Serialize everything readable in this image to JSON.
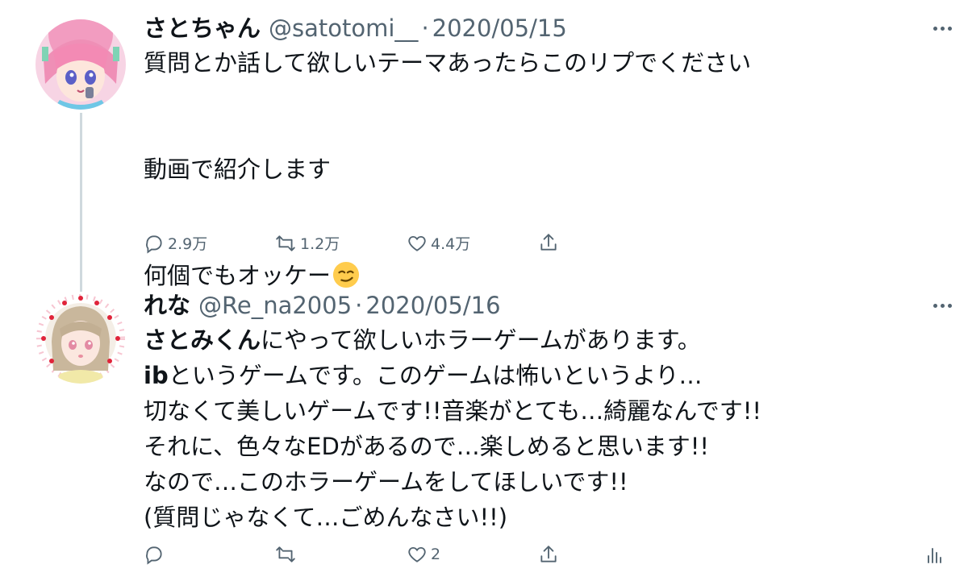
{
  "tweet1": {
    "display_name": "さとちゃん",
    "handle": "@satotomi__",
    "separator": "·",
    "date": "2020/05/15",
    "text_line1": "質問とか話して欲しいテーマあったらこのリプでください",
    "text_line2": "動画で紹介します",
    "text_line3": "何個でもオッケー",
    "reply_count": "2.9万",
    "retweet_count": "1.2万",
    "like_count": "4.4万"
  },
  "tweet2": {
    "display_name": "れな",
    "handle": "@Re_na2005",
    "separator": "·",
    "date": "2020/05/16",
    "line1_bold": "さとみくん",
    "line1_rest": "にやって欲しいホラーゲームがあります。",
    "line2_bold": "ib",
    "line2_rest": "というゲームです。このゲームは怖いというより…",
    "line3": "切なくて美しいゲームです!!音楽がとても…綺麗なんです!!",
    "line4": "それに、色々なEDがあるので…楽しめると思います!!",
    "line5": "なので…このホラーゲームをしてほしいです!!",
    "line6": "(質問じゃなくて…ごめんなさい!!)",
    "reply_count": "",
    "retweet_count": "",
    "like_count": "2"
  },
  "colors": {
    "text": "#0f1419",
    "secondary": "#536471",
    "thread_line": "#cfd9de"
  },
  "icons": [
    "reply-icon",
    "retweet-icon",
    "like-icon",
    "share-icon",
    "more-icon",
    "analytics-icon",
    "smirk-emoji"
  ]
}
